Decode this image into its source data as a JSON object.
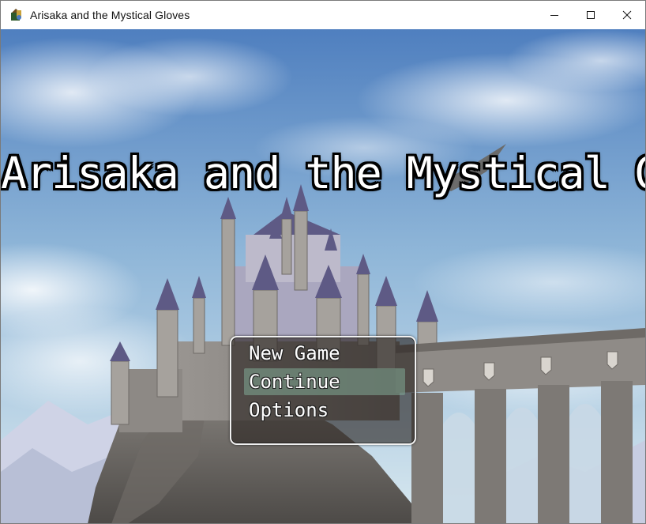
{
  "window": {
    "title": "Arisaka and the Mystical Gloves",
    "controls": [
      "minimize-icon",
      "maximize-icon",
      "close-icon"
    ]
  },
  "game": {
    "title": "Arisaka and the Mystical Gloves",
    "menu": {
      "items": [
        {
          "label": "New Game",
          "selected": false
        },
        {
          "label": "Continue",
          "selected": true
        },
        {
          "label": "Options",
          "selected": false
        }
      ]
    }
  },
  "colors": {
    "sky_top": "#5a88c4",
    "sky_bottom": "#cfe3ef",
    "castle": "#9a9793",
    "spire": "#5e5a85",
    "highlight": "#86ae98"
  }
}
